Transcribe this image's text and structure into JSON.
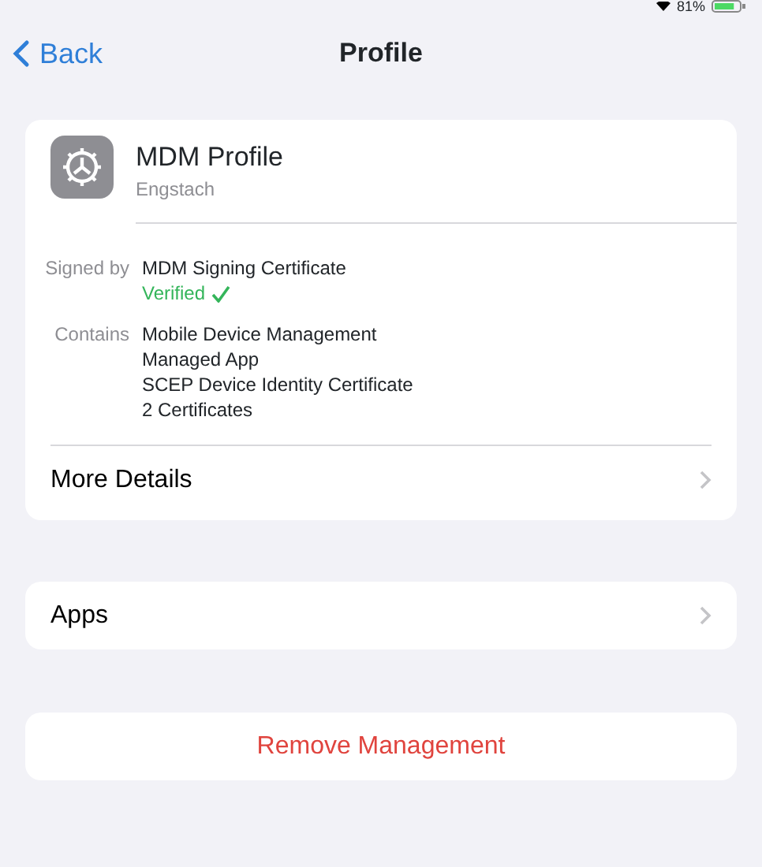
{
  "status_bar": {
    "battery": "81%",
    "charging": true
  },
  "nav": {
    "back": "Back",
    "title": "Profile"
  },
  "profile": {
    "name": "MDM Profile",
    "organization": "Engstach",
    "details": [
      {
        "label": "Signed by",
        "values": [
          "MDM Signing Certificate"
        ],
        "verified": true,
        "verified_text": "Verified"
      },
      {
        "label": "Contains",
        "values": [
          "Mobile Device Management",
          "Managed App",
          "SCEP Device Identity Certificate",
          "2 Certificates"
        ],
        "verified": false
      }
    ],
    "more": "More Details"
  },
  "apps": "Apps",
  "remove": "Remove Management"
}
